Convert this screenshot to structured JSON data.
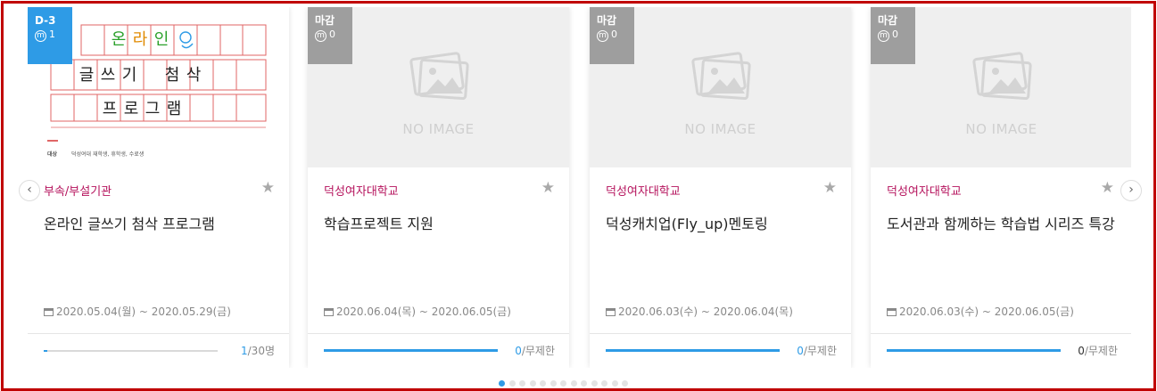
{
  "colors": {
    "frame": "#c00000",
    "accent": "#2e9be6",
    "org": "#b5125c",
    "badge_gray": "#9e9e9e"
  },
  "nav": {
    "prev_icon": "chevron-left-icon",
    "next_icon": "chevron-right-icon",
    "prev": "‹",
    "next": "›"
  },
  "pagination": {
    "count": 13,
    "active_index": 0
  },
  "cards": [
    {
      "badge": {
        "dday": "D-3",
        "m": "m",
        "count": "1",
        "style": "blue"
      },
      "poster": {
        "line1": [
          "온",
          "라",
          "인"
        ],
        "line2": [
          "글",
          "쓰",
          "기",
          "",
          "첨",
          "삭"
        ],
        "line3": [
          "프",
          "로",
          "그",
          "램"
        ],
        "caption_label": "대상",
        "caption_text": "덕성여대 재학생, 휴학생, 수료생"
      },
      "org": "부속/부설기관",
      "title": "온라인 글쓰기 첨삭 프로그램",
      "date": "2020.05.04(월) ~ 2020.05.29(금)",
      "progress": {
        "current": "1",
        "total": "/30명",
        "fraction": 0.02
      }
    },
    {
      "badge": {
        "dday": "마감",
        "m": "m",
        "count": "0",
        "style": "gray"
      },
      "noimage": "NO IMAGE",
      "org": "덕성여자대학교",
      "title": "학습프로젝트 지원",
      "date": "2020.06.04(목) ~ 2020.06.05(금)",
      "progress": {
        "current": "0",
        "total": "/무제한",
        "fraction": 1
      }
    },
    {
      "badge": {
        "dday": "마감",
        "m": "m",
        "count": "0",
        "style": "gray"
      },
      "noimage": "NO IMAGE",
      "org": "덕성여자대학교",
      "title": "덕성캐치업(Fly_up)멘토링",
      "date": "2020.06.03(수) ~ 2020.06.04(목)",
      "progress": {
        "current": "0",
        "total": "/무제한",
        "fraction": 1
      }
    },
    {
      "badge": {
        "dday": "마감",
        "m": "m",
        "count": "0",
        "style": "gray"
      },
      "noimage": "NO IMAGE",
      "org": "덕성여자대학교",
      "title": "도서관과 함께하는 학습법 시리즈 특강",
      "date": "2020.06.03(수) ~ 2020.06.05(금)",
      "progress": {
        "current": "0",
        "total": "/무제한",
        "fraction": 1
      }
    }
  ]
}
